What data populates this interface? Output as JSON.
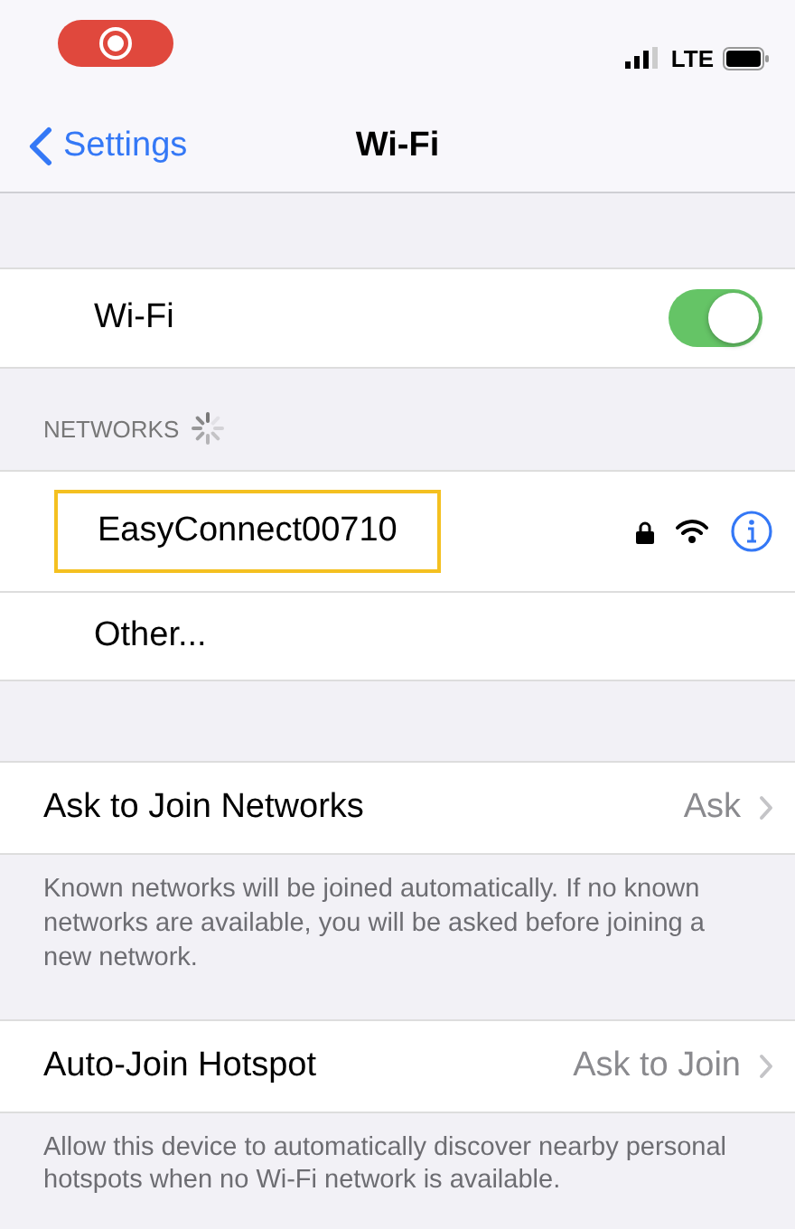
{
  "status_bar": {
    "network_type": "LTE"
  },
  "nav_bar": {
    "back": "Settings",
    "title": "Wi-Fi"
  },
  "wifi": {
    "label": "Wi-Fi",
    "on": true
  },
  "networks": {
    "header": "NETWORKS",
    "items": [
      {
        "name": "EasyConnect00710",
        "locked": true,
        "highlighted": true
      }
    ],
    "other": "Other..."
  },
  "settings": [
    {
      "label": "Ask to Join Networks",
      "value": "Ask",
      "description": "Known networks will be joined automatically. If no known networks are available, you will be asked before joining a new network."
    },
    {
      "label": "Auto-Join Hotspot",
      "value": "Ask to Join",
      "description": "Allow this device to automatically discover nearby personal hotspots when no Wi-Fi network is available."
    }
  ]
}
